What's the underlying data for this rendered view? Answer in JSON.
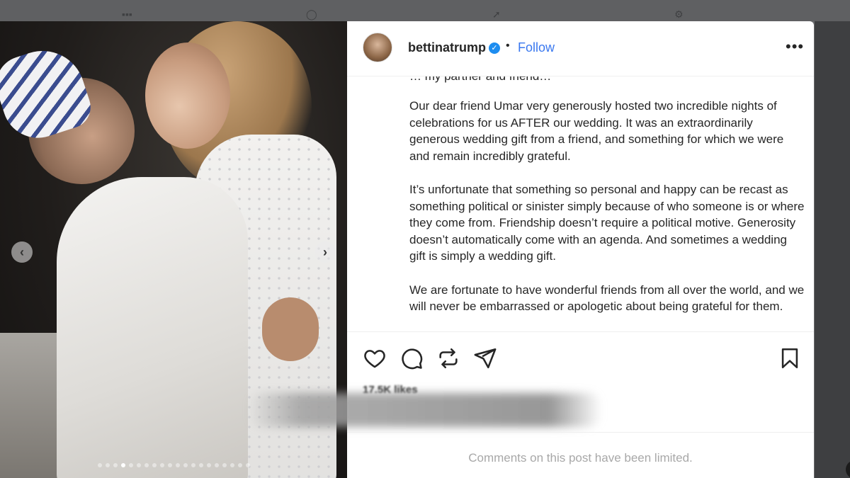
{
  "post": {
    "username": "bettinatrump",
    "verified_mark": "✓",
    "separator": "•",
    "follow_label": "Follow",
    "more_label": "•••",
    "caption_cut_line": "… my partner and friend… ",
    "caption_paragraphs": [
      "Our dear friend Umar very generously hosted two incredible nights of celebrations for us AFTER our wedding. It was an extraordinarily generous wedding gift from a friend, and something for which we were and remain incredibly grateful.",
      "It’s unfortunate that something so personal and happy can be recast as something political or sinister simply because of who someone is or where they come from. Friendship doesn’t require a political motive. Generosity doesn’t automatically come with an agenda. And sometimes a wedding gift is simply a wedding gift.",
      "We are fortunate to have wonderful friends from all over the world, and we will never be embarrassed or apologetic about being grateful for them."
    ],
    "likes_text": "17.5K likes",
    "comments_limited_text": "Comments on this post have been limited."
  },
  "carousel": {
    "prev_label": "‹",
    "next_label": "›",
    "slide_count": 20,
    "active_slide_index": 3
  },
  "icons": {
    "like": "heart-icon",
    "comment": "comment-icon",
    "repost": "repost-icon",
    "share": "send-icon",
    "save": "bookmark-icon",
    "more": "more-icon"
  },
  "colors": {
    "follow": "#3a78ef",
    "verified": "#1d8df0",
    "text": "#262626",
    "muted": "#a8a8a8"
  }
}
